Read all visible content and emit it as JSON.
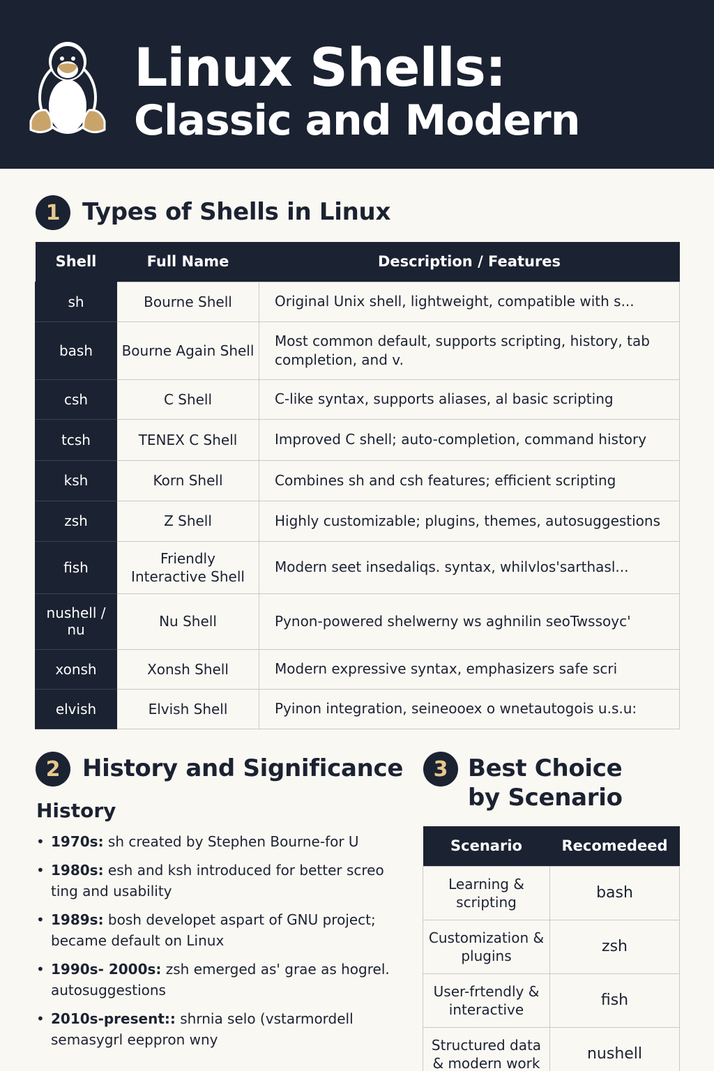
{
  "header": {
    "title_line1": "Linux Shells:",
    "title_line2": "Classic and Modern",
    "logo_icon": "penguin-icon"
  },
  "section1": {
    "number": "1",
    "title": "Types of Shells in Linux",
    "columns": [
      "Shell",
      "Full Name",
      "Description / Features"
    ],
    "rows": [
      {
        "shell": "sh",
        "full_name": "Bourne Shell",
        "description": "Original Unix shell, lightweight, compatible with s..."
      },
      {
        "shell": "bash",
        "full_name": "Bourne Again Shell",
        "description": "Most common default, supports scripting, history, tab completion, and v."
      },
      {
        "shell": "csh",
        "full_name": "C Shell",
        "description": "C-like syntax, supports aliases, al basic scripting"
      },
      {
        "shell": "tcsh",
        "full_name": "TENEX C Shell",
        "description": "Improved C shell; auto-completion, command history"
      },
      {
        "shell": "ksh",
        "full_name": "Korn Shell",
        "description": "Combines sh and csh features; efficient scripting"
      },
      {
        "shell": "zsh",
        "full_name": "Z Shell",
        "description": "Highly customizable; plugins, themes, autosuggestions"
      },
      {
        "shell": "fish",
        "full_name": "Friendly Interactive Shell",
        "description": "Modern seet insedaliqs. syntax, whilvlos'sarthasl..."
      },
      {
        "shell": "nushell / nu",
        "full_name": "Nu Shell",
        "description": "Pynon-powered shelwerny ws aghnilin seoTwssoyc'"
      },
      {
        "shell": "xonsh",
        "full_name": "Xonsh Shell",
        "description": "Modern expressive syntax, emphasizers safe scri"
      },
      {
        "shell": "elvish",
        "full_name": "Elvish Shell",
        "description": "Pyinon integration, seineooex o wnetautogois u.s.u:"
      }
    ]
  },
  "section2": {
    "number": "2",
    "title": "History and Significance",
    "subheading": "History",
    "items": [
      {
        "period": "1970s:",
        "text": " sh created by Stephen Bourne-for U"
      },
      {
        "period": "1980s:",
        "text": " esh and ksh introduced for better screo ting and usability"
      },
      {
        "period": "1989s:",
        "text": " bosh developet aspart of GNU project; became default on Linux"
      },
      {
        "period": "1990s- 2000s:",
        "text": " zsh emerged as' grae as hogrel. autosuggestions"
      },
      {
        "period": "2010s-present::",
        "text": " shrnia selo (vstarmordell semasygrl eeppron wny"
      }
    ]
  },
  "section3": {
    "number": "3",
    "title_line1": "Best Choice",
    "title_line2": "by Scenario",
    "columns": [
      "Scenario",
      "Recomedeed"
    ],
    "rows": [
      {
        "scenario": "Learning & scripting",
        "recommended": "bash"
      },
      {
        "scenario": "Customization & plugins",
        "recommended": "zsh"
      },
      {
        "scenario": "User-frtendly & interactive",
        "recommended": "fish"
      },
      {
        "scenario": "Structured data & modern work",
        "recommended": "nushell"
      }
    ]
  },
  "colors": {
    "navy": "#1b2231",
    "page_background": "#faf8f3",
    "accent_gold": "#e6c88e"
  }
}
